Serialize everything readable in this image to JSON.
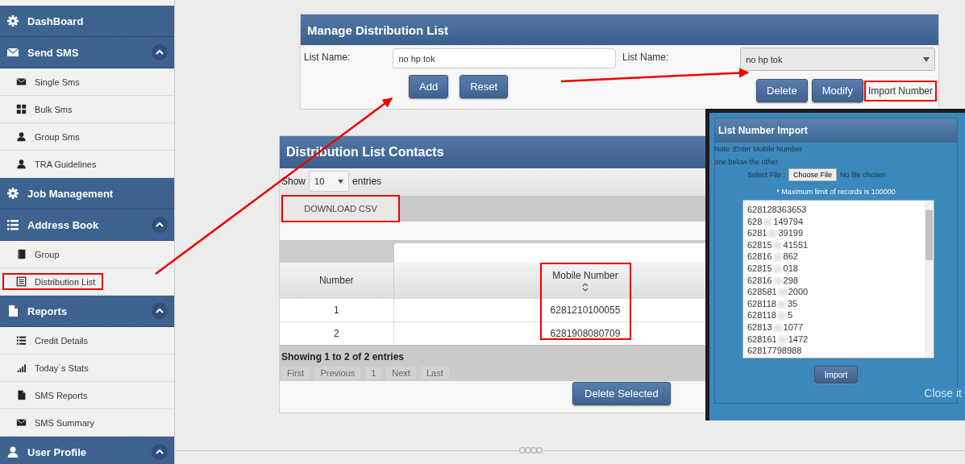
{
  "sidebar": {
    "items": [
      {
        "label": "DashBoard"
      },
      {
        "label": "Send SMS",
        "expanded": true,
        "children": [
          {
            "label": "Single Sms",
            "highlighted": false
          },
          {
            "label": "Bulk Sms",
            "highlighted": false
          },
          {
            "label": "Group Sms",
            "highlighted": false
          },
          {
            "label": "TRA Guidelines",
            "highlighted": false
          }
        ]
      },
      {
        "label": "Job Management"
      },
      {
        "label": "Address Book",
        "expanded": true,
        "children": [
          {
            "label": "Group",
            "highlighted": false
          },
          {
            "label": "Distribution List",
            "highlighted": true
          }
        ]
      },
      {
        "label": "Reports",
        "expanded": true,
        "children": [
          {
            "label": "Credit Details",
            "highlighted": false
          },
          {
            "label": "Today`s Stats",
            "highlighted": false
          },
          {
            "label": "SMS Reports",
            "highlighted": false
          },
          {
            "label": "SMS Summary",
            "highlighted": false
          }
        ]
      },
      {
        "label": "User Profile",
        "expanded": true
      }
    ]
  },
  "manage_panel": {
    "title": "Manage Distribution List",
    "list_name_label": "List Name:",
    "list_name_value": "no hp tok",
    "select_label": "List Name:",
    "select_value": "no hp tok",
    "buttons": [
      "Add",
      "Reset"
    ],
    "actions": [
      "Delete",
      "Modify"
    ],
    "import_link": {
      "label": "Import Number",
      "highlighted": true
    }
  },
  "contacts_panel": {
    "title": "Distribution List Contacts",
    "show_label": "Show",
    "page_size": "10",
    "entries_label": "entries",
    "download_button": {
      "label": "DOWNLOAD CSV",
      "highlighted": true
    },
    "columns": [
      {
        "label": "Number",
        "highlighted": false,
        "sortable": false
      },
      {
        "label": "Mobile Number",
        "highlighted": true,
        "sortable": true
      }
    ],
    "rows": [
      [
        "1",
        "6281210100055"
      ],
      [
        "2",
        "6281908080709"
      ]
    ],
    "info": "Showing 1 to 2 of 2 entries",
    "pager": [
      {
        "label": "First",
        "disabled": true
      },
      {
        "label": "Previous",
        "disabled": true
      },
      {
        "label": "1",
        "disabled": true
      },
      {
        "label": "Next",
        "disabled": true
      },
      {
        "label": "Last",
        "disabled": true
      }
    ],
    "delete_button": "Delete Selected"
  },
  "import_dialog": {
    "title": "List Number Import",
    "note_lines": [
      "Note :Enter Mobile Number",
      "one below the other"
    ],
    "file_label": "Select File :",
    "file_button": "Choose File",
    "file_status": "No file chosen",
    "limit_note": "* Maximum limit of records is 100000",
    "numbers": [
      {
        "start": "628128363653"
      },
      {
        "start": "628",
        "end": "149794"
      },
      {
        "start": "6281",
        "end": "39199"
      },
      {
        "start": "62815",
        "end": "41551"
      },
      {
        "start": "62816",
        "end": "862"
      },
      {
        "start": "62815",
        "end": "018"
      },
      {
        "start": "62816",
        "end": "298"
      },
      {
        "start": "628581",
        "end": "2000"
      },
      {
        "start": "628118",
        "end": "35"
      },
      {
        "start": "628118",
        "end": "5"
      },
      {
        "start": "62813",
        "end": "1077"
      },
      {
        "start": "628161",
        "end": "1472"
      },
      {
        "start": "62817798988"
      }
    ],
    "import_button": "Import",
    "close_link": "Close it"
  }
}
